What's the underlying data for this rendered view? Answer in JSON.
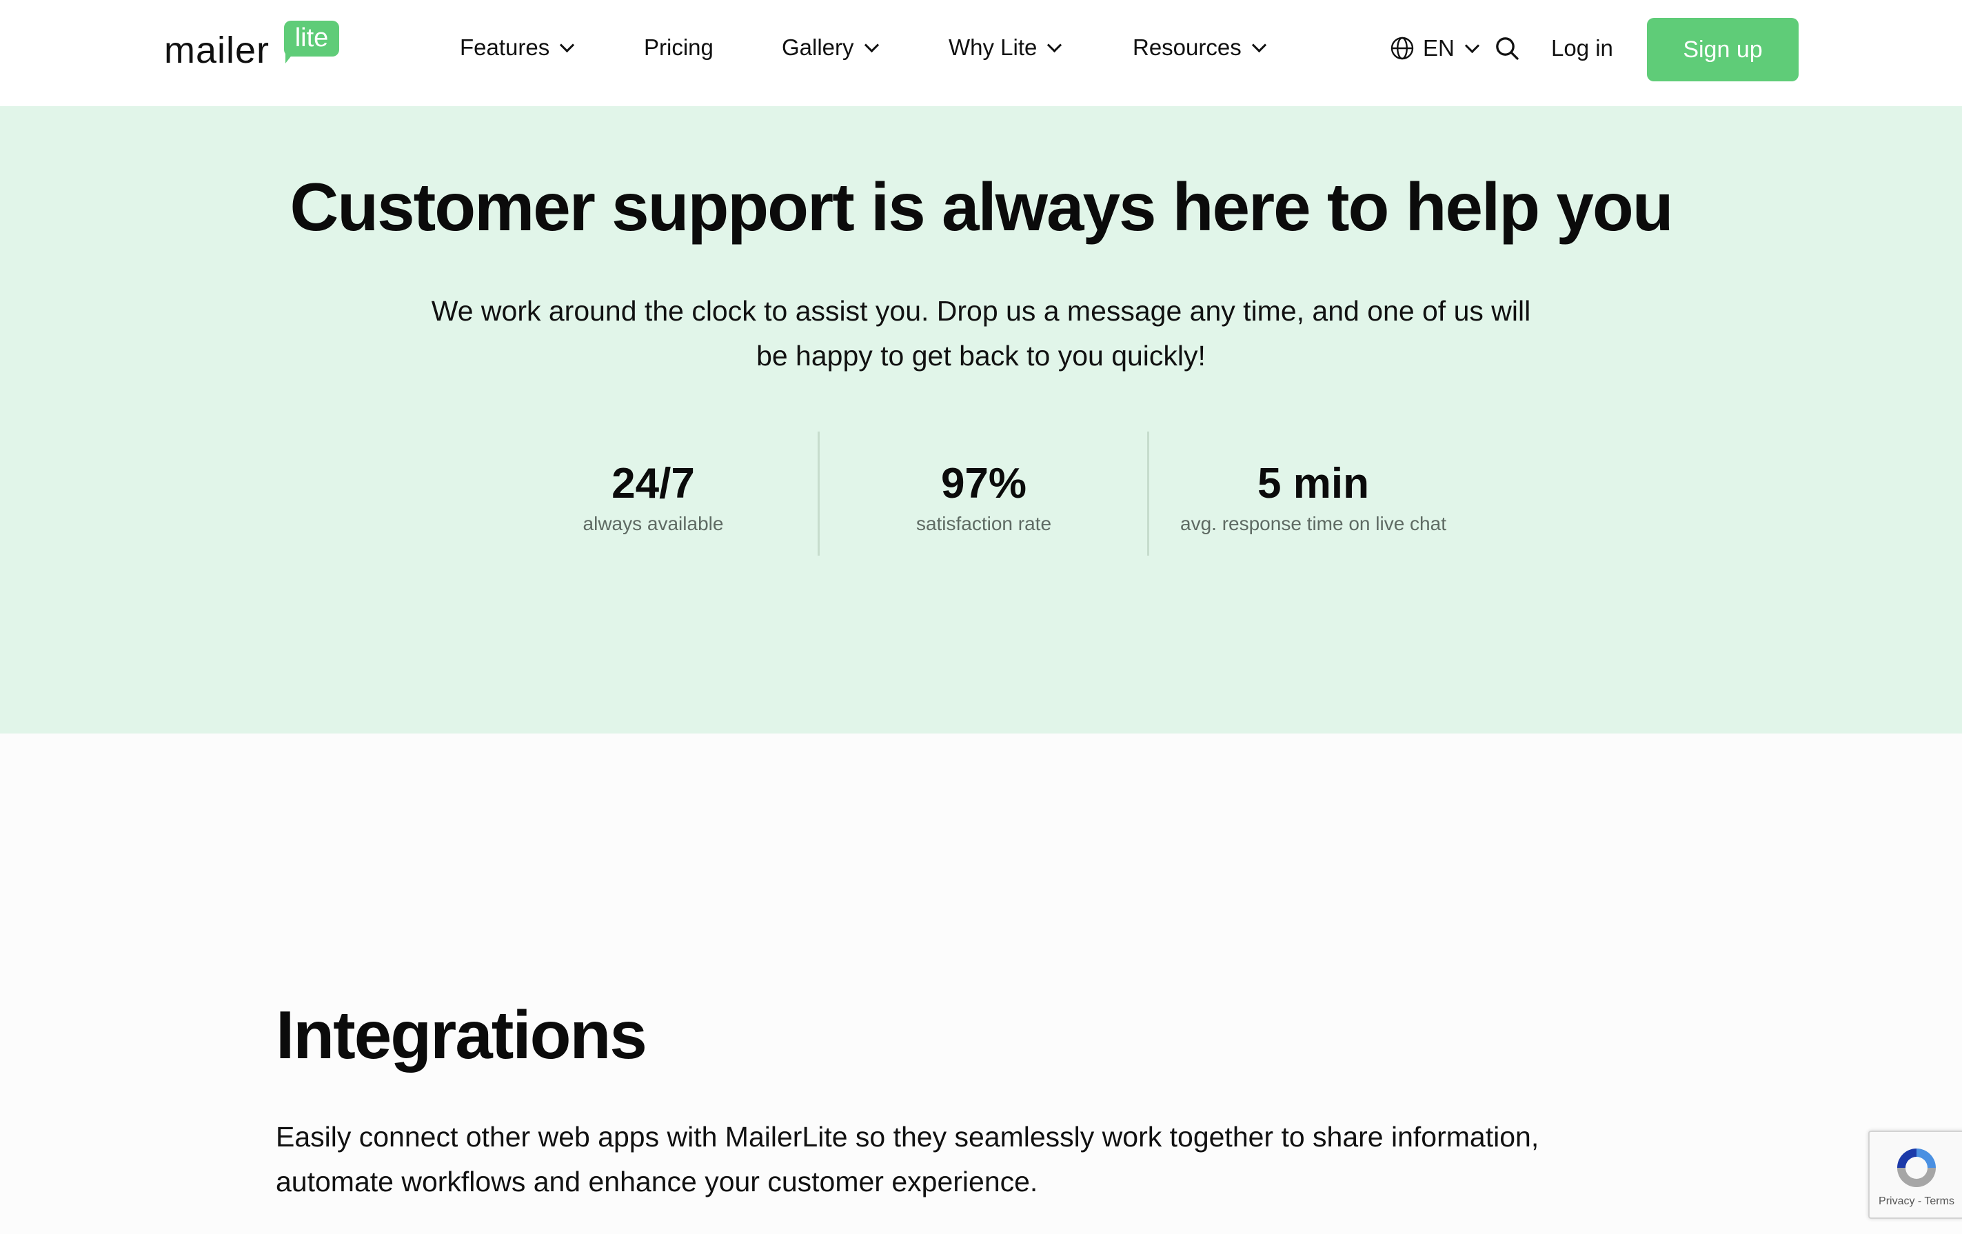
{
  "header": {
    "logo": {
      "word": "mailer",
      "badge": "lite"
    },
    "nav": [
      {
        "label": "Features",
        "has_dropdown": true
      },
      {
        "label": "Pricing",
        "has_dropdown": false
      },
      {
        "label": "Gallery",
        "has_dropdown": true
      },
      {
        "label": "Why Lite",
        "has_dropdown": true
      },
      {
        "label": "Resources",
        "has_dropdown": true
      }
    ],
    "language": "EN",
    "login_label": "Log in",
    "signup_label": "Sign up",
    "icons": {
      "language": "globe-icon",
      "search": "search-icon"
    }
  },
  "hero": {
    "title": "Customer support is always here to help you",
    "subtitle": "We work around the clock to assist you. Drop us a message any time, and one of us will be happy to get back to you quickly!",
    "stats": [
      {
        "value": "24/7",
        "label": "always available"
      },
      {
        "value": "97%",
        "label": "satisfaction rate"
      },
      {
        "value": "5 min",
        "label": "avg. response time on live chat"
      }
    ]
  },
  "integrations": {
    "title": "Integrations",
    "text": "Easily connect other web apps with MailerLite so they seamlessly work together to share information, automate workflows and enhance your customer experience."
  },
  "recaptcha": {
    "privacy": "Privacy",
    "separator": " - ",
    "terms": "Terms"
  },
  "colors": {
    "brand_green": "#5fcc78",
    "hero_bg": "#e1f5e9",
    "text": "#0b0b0b",
    "muted": "#5e6a63"
  }
}
